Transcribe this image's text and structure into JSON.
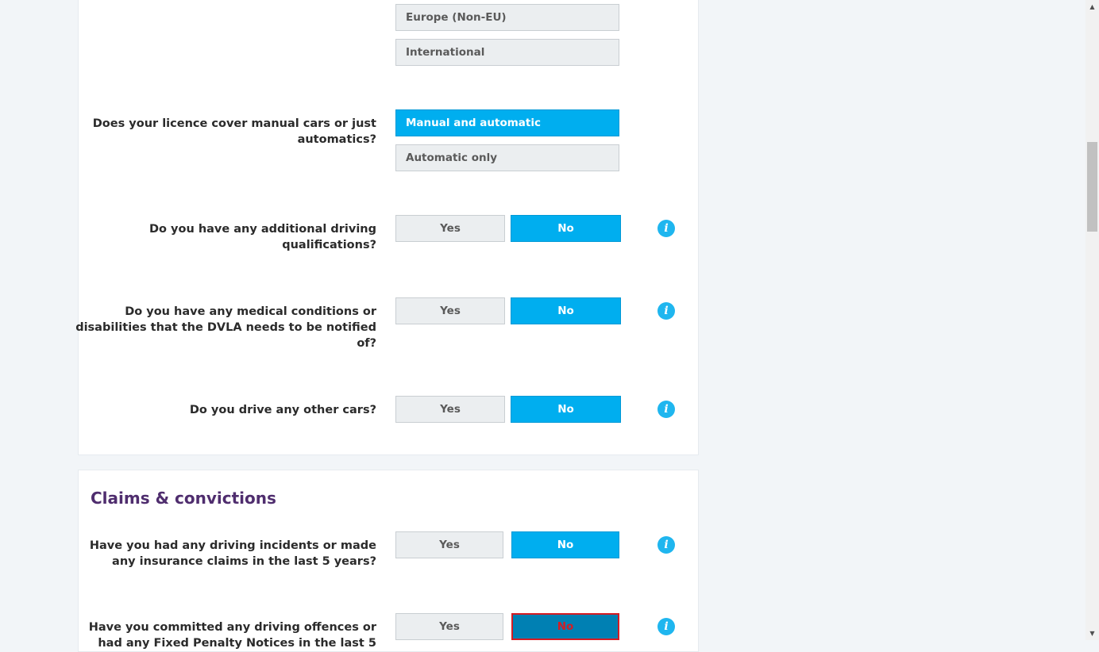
{
  "licence_region": {
    "options": [
      "Europe (Non-EU)",
      "International"
    ]
  },
  "licence_type": {
    "question": "Does your licence cover manual cars or just automatics?",
    "options": [
      "Manual and automatic",
      "Automatic only"
    ],
    "selected": "Manual and automatic"
  },
  "qualifications": {
    "question": "Do you have any additional driving qualifications?",
    "yes": "Yes",
    "no": "No",
    "selected": "No"
  },
  "medical": {
    "question": "Do you have any medical conditions or disabilities that the DVLA needs to be notified of?",
    "yes": "Yes",
    "no": "No",
    "selected": "No"
  },
  "other_cars": {
    "question": "Do you drive any other cars?",
    "yes": "Yes",
    "no": "No",
    "selected": "No"
  },
  "claims_section": {
    "title": "Claims & convictions",
    "incidents": {
      "question": "Have you had any driving incidents or made any insurance claims in the last 5 years?",
      "yes": "Yes",
      "no": "No",
      "selected": "No"
    },
    "offences": {
      "question": "Have you committed any driving offences or had any Fixed Penalty Notices in the last 5",
      "yes": "Yes",
      "no": "No",
      "selected": "No"
    }
  },
  "icons": {
    "info": "info-icon",
    "info_glyph": "i"
  },
  "colors": {
    "accent": "#00aeef",
    "section_title": "#4f2d6e",
    "focus_border": "#d51c23"
  }
}
